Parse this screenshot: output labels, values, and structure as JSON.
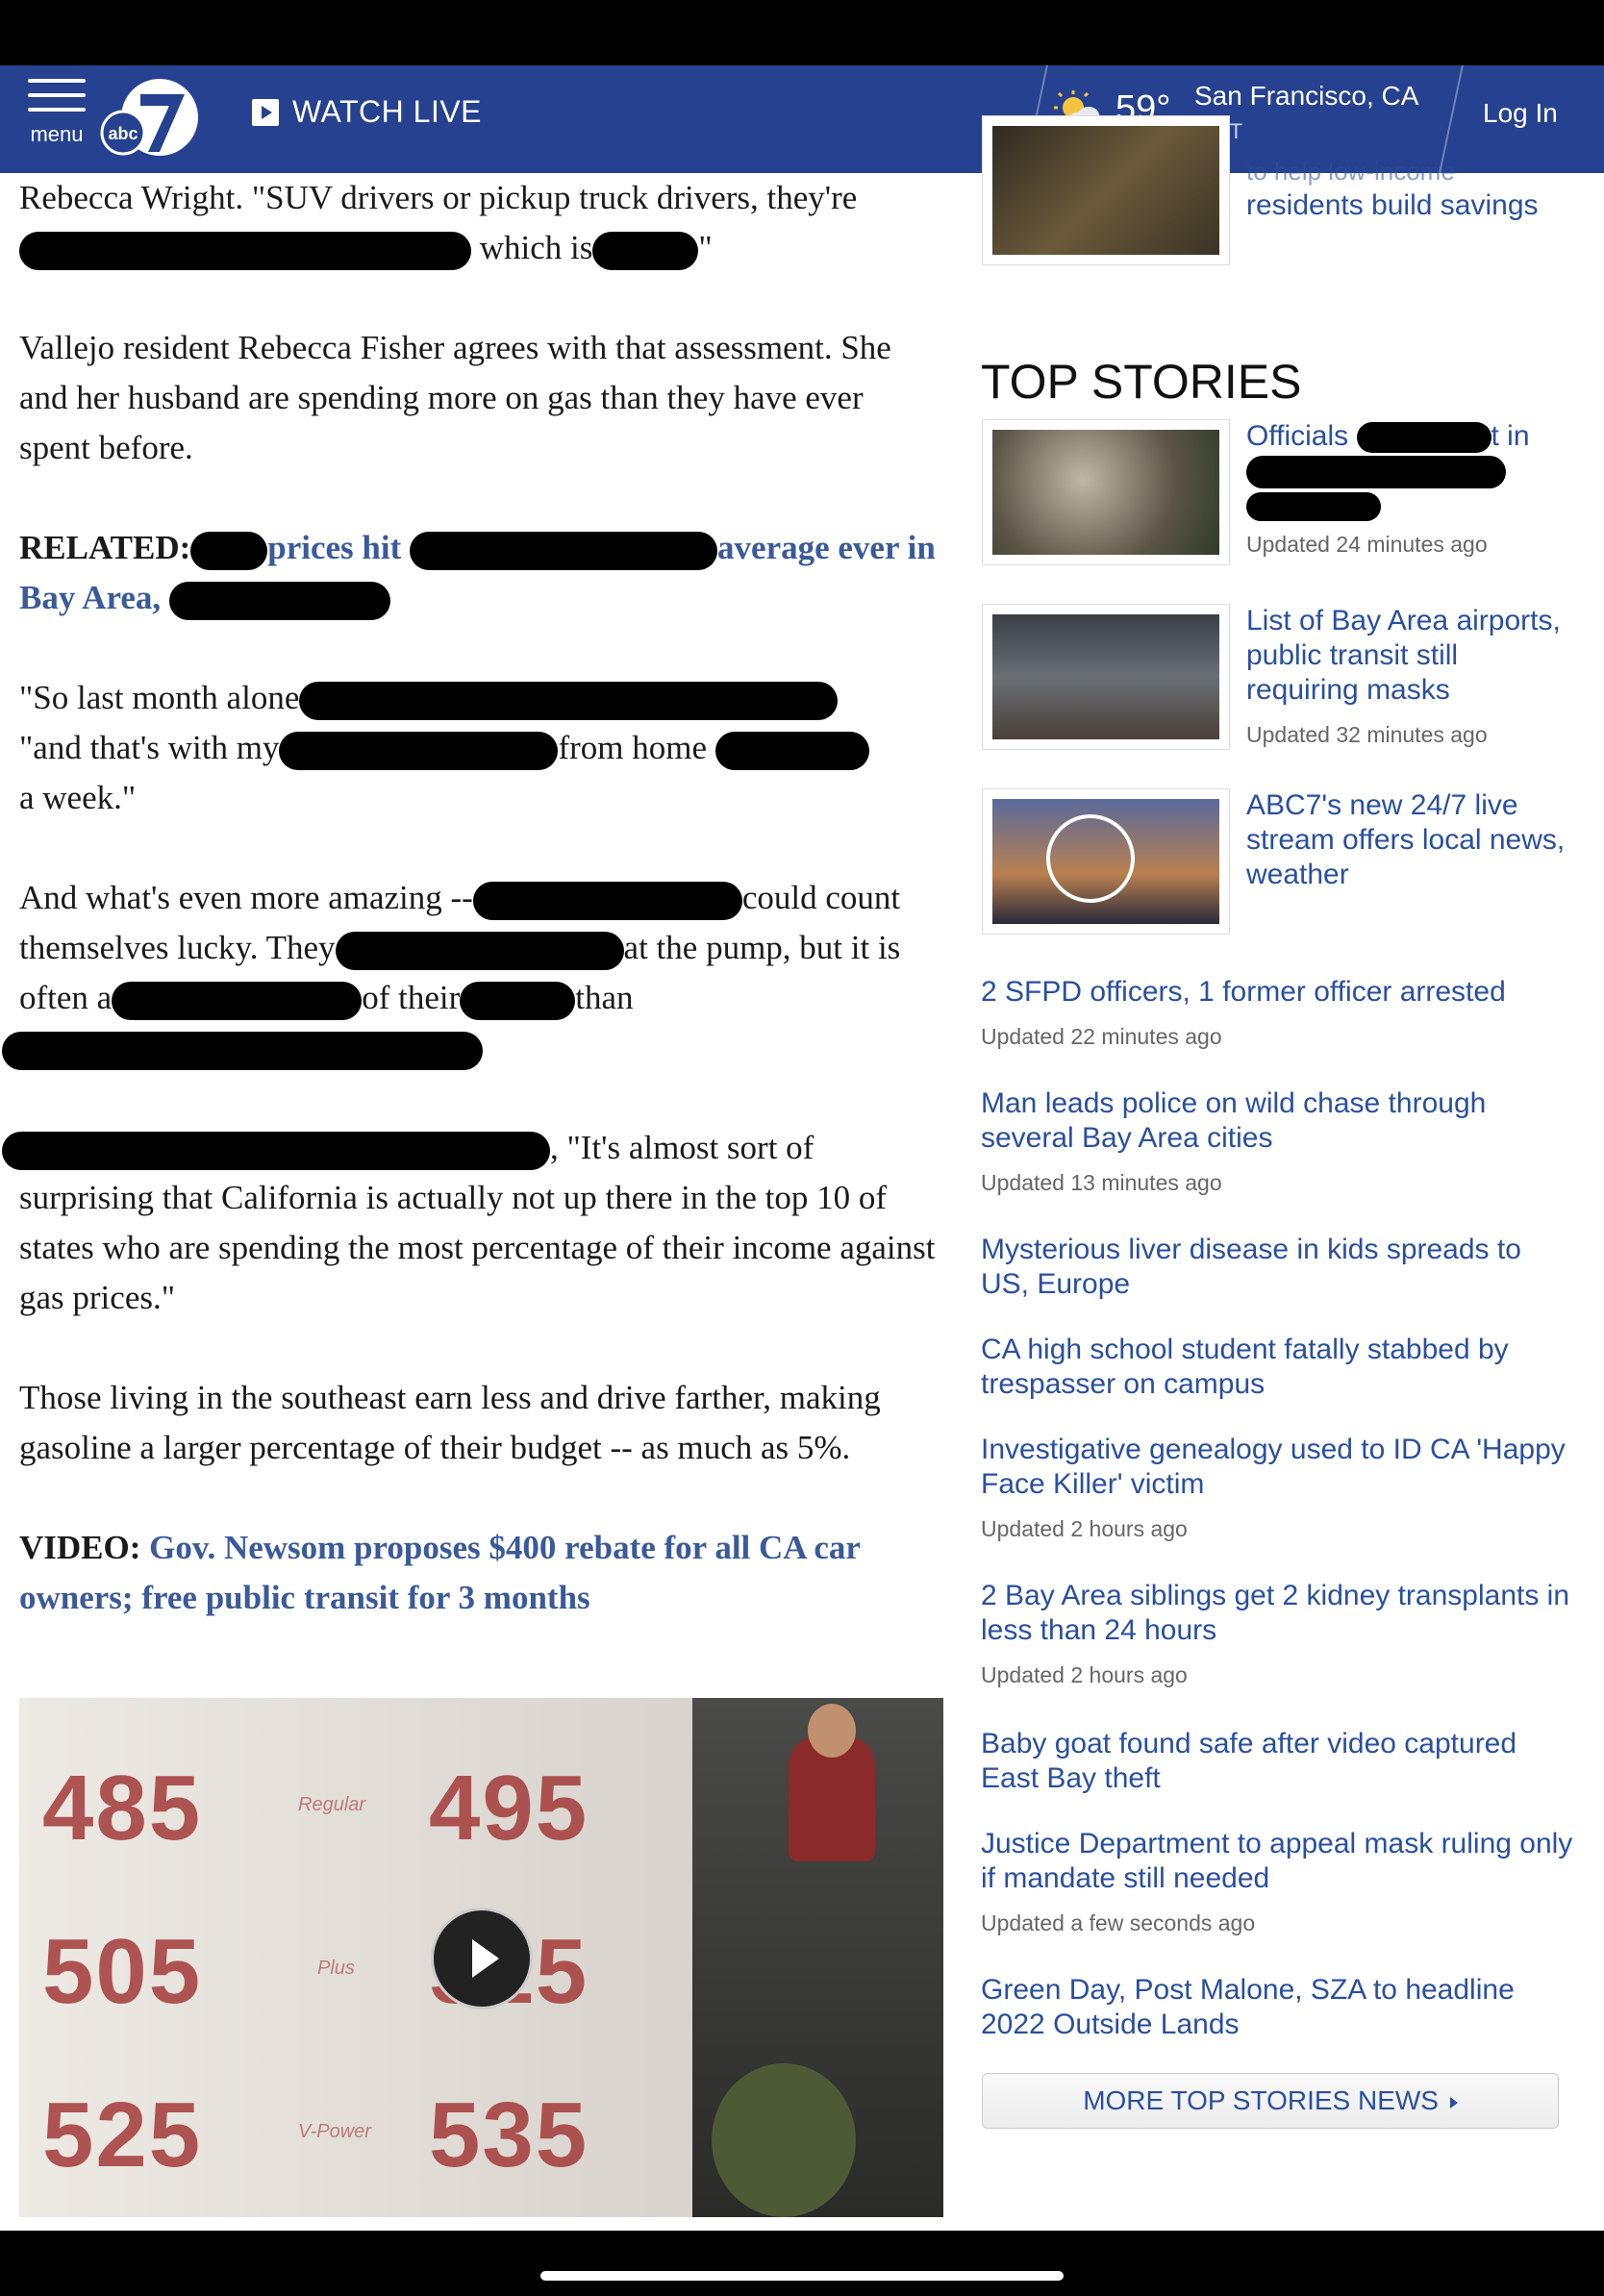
{
  "header": {
    "menu_label": "menu",
    "logo_text": "abc",
    "watch_live": "WATCH LIVE",
    "temperature": "59°",
    "city": "San Francisco, CA",
    "edit_label": "EDIT",
    "login": "Log In"
  },
  "article": {
    "p1_start": "Rebecca Wright. \"SUV drivers or pickup truck drivers, they're",
    "p1_mid": " which is",
    "p1_end": "\"",
    "p2": "Vallejo resident Rebecca Fisher agrees with that assessment. She and her husband are spending more on gas than they have ever spent before.",
    "related_label": "RELATED:",
    "related_a": "prices hit",
    "related_b": "average ever in Bay Area,",
    "p3_a": "\"So last month alone",
    "p3_b": "\"and that's with my",
    "p3_c": "from home",
    "p3_d": "a week.\"",
    "p4_a": "And what's even more amazing --",
    "p4_b": "could count themselves lucky. They",
    "p4_c": "at the pump, but it is often a",
    "p4_d": "of their",
    "p4_e": "than",
    "p5_a": ", \"It's almost sort of surprising that California is actually not up there in the top 10 of states who are spending the most percentage of their income against gas prices.\"",
    "p6": "Those living in the southeast earn less and drive farther, making gasoline a larger percentage of their budget -- as much as 5%.",
    "video_label": "VIDEO:",
    "video_link": "Gov. Newsom proposes $400 rebate for all CA car owners; free public transit for 3 months"
  },
  "video": {
    "prices": [
      "485",
      "495",
      "505",
      "515",
      "525",
      "535"
    ],
    "grades": [
      "Regular",
      "Plus",
      "V-Power"
    ]
  },
  "sidebar": {
    "top_snip": "residents build savings",
    "top_snip_cut": "to help low-income",
    "top_stories_title": "TOP STORIES",
    "featured": [
      {
        "title": "Officials",
        "title_end": "t in",
        "updated": "Updated 24 minutes ago"
      },
      {
        "title": "List of Bay Area airports, public transit still requiring masks",
        "updated": "Updated 32 minutes ago"
      },
      {
        "title": "ABC7's new 24/7 live stream offers local news, weather",
        "updated": ""
      }
    ],
    "list": [
      {
        "title": "2 SFPD officers, 1 former officer arrested",
        "updated": "Updated 22 minutes ago"
      },
      {
        "title": "Man leads police on wild chase through several Bay Area cities",
        "updated": "Updated 13 minutes ago"
      },
      {
        "title": "Mysterious liver disease in kids spreads to US, Europe",
        "updated": ""
      },
      {
        "title": "CA high school student fatally stabbed by trespasser on campus",
        "updated": ""
      },
      {
        "title": "Investigative genealogy used to ID CA 'Happy Face Killer' victim",
        "updated": "Updated 2 hours ago"
      },
      {
        "title": "2 Bay Area siblings get 2 kidney transplants in less than 24 hours",
        "updated": "Updated 2 hours ago"
      },
      {
        "title": "Baby goat found safe after video captured East Bay theft",
        "updated": ""
      },
      {
        "title": "Justice Department to appeal mask ruling only if mandate still needed",
        "updated": "Updated a few seconds ago"
      },
      {
        "title": "Green Day, Post Malone, SZA to headline 2022 Outside Lands",
        "updated": ""
      }
    ],
    "more_button": "MORE TOP STORIES NEWS"
  },
  "colors": {
    "header_bg": "#26418f",
    "link": "#2a4fa0",
    "article_link": "#3a5a9b"
  }
}
